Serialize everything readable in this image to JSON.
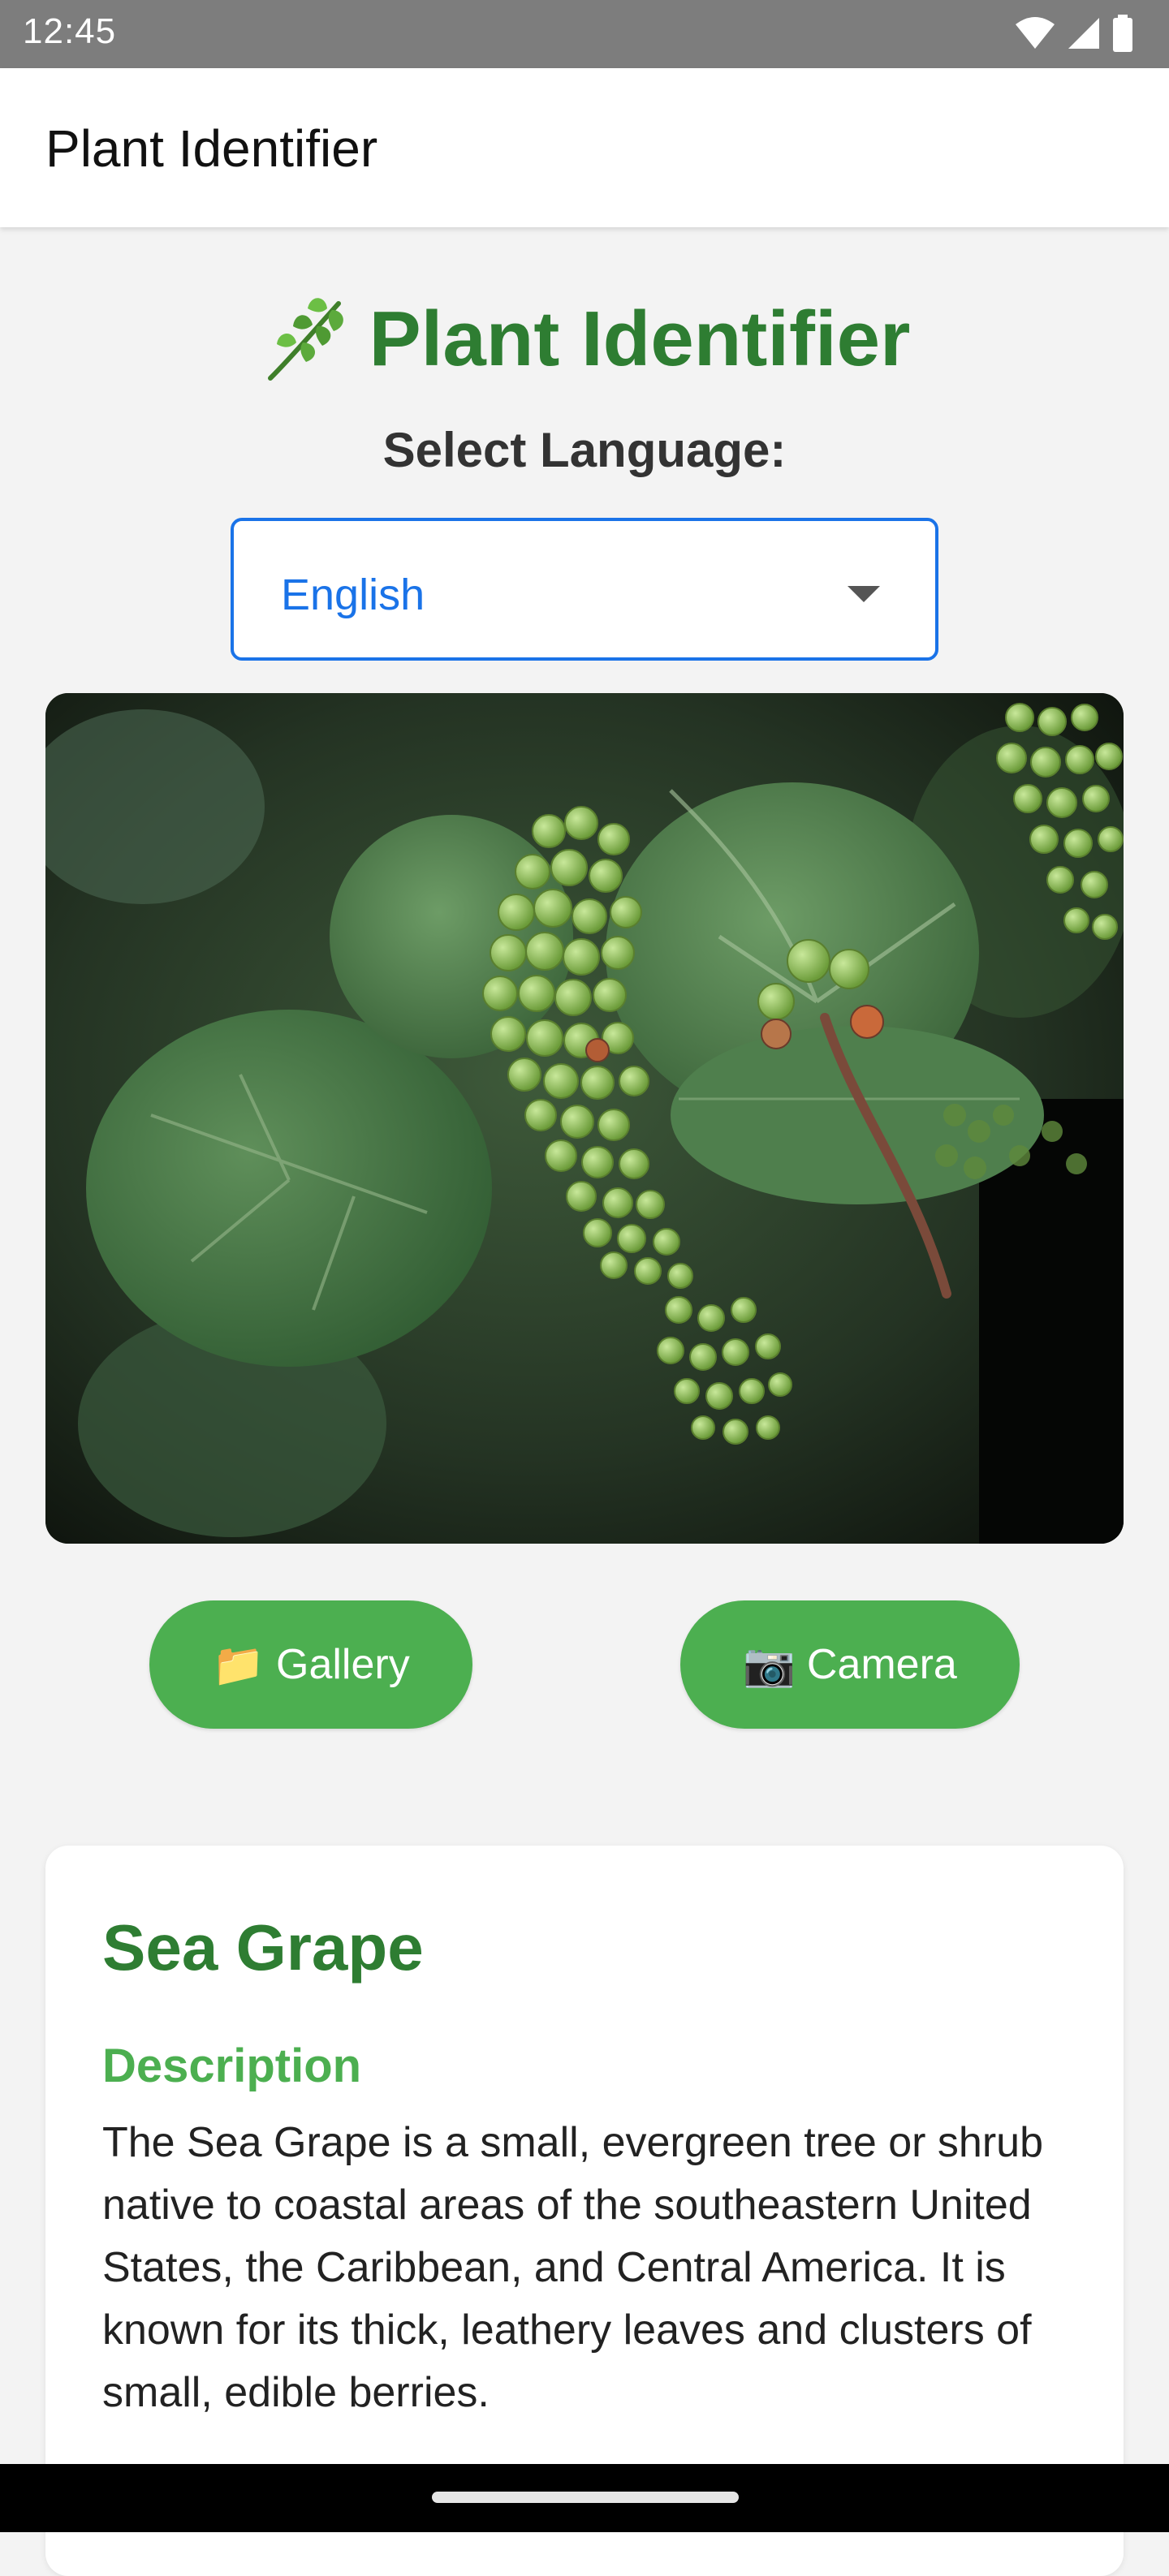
{
  "status_bar": {
    "time": "12:45",
    "icons": [
      "wifi-icon",
      "cell-signal-icon",
      "battery-icon"
    ]
  },
  "app_bar": {
    "title": "Plant Identifier"
  },
  "header": {
    "emoji": "🌿",
    "title": "Plant Identifier"
  },
  "language": {
    "label": "Select Language:",
    "selected": "English"
  },
  "actions": {
    "gallery": {
      "icon": "📁",
      "label": "Gallery"
    },
    "camera": {
      "icon": "📷",
      "label": "Camera"
    }
  },
  "result": {
    "name": "Sea Grape",
    "section_title": "Description",
    "description": "The Sea Grape is a small, evergreen tree or shrub native to coastal areas of the southeastern United States, the Caribbean, and Central America. It is known for its thick, leathery leaves and clusters of small, edible berries."
  },
  "colors": {
    "primary_green": "#2e7d32",
    "button_green": "#4caf50",
    "select_blue": "#1a73e8"
  }
}
